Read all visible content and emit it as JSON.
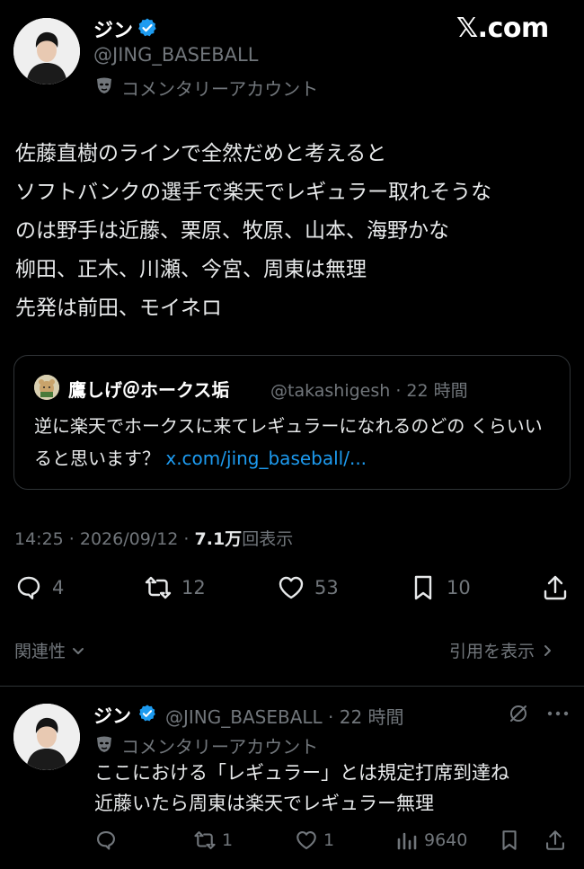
{
  "brand": "𝕏.com",
  "tweet": {
    "name": "ジン",
    "handle": "@JING_BASEBALL",
    "label": "コメンタリーアカウント",
    "body": "佐藤直樹のラインで全然だめと考えると\nソフトバンクの選手で楽天でレギュラー取れそうな\nのは野手は近藤、栗原、牧原、山本、海野かな\n柳田、正木、川瀬、今宮、周東は無理\n先発は前田、モイネロ",
    "timestamp": "14:25 · 2026/09/12 · ",
    "views": "7.1万",
    "views_suffix": "回表示"
  },
  "quote": {
    "name": "鷹しげ＠ホークス垢",
    "meta": "@takashigesh · 22 時間",
    "text": "逆に楽天でホークスに来てレギュラーになれるのどの くらいいると思います？ ",
    "link": "x.com/jing_baseball/..."
  },
  "actions": {
    "reply": "4",
    "retweet": "12",
    "like": "53",
    "bookmark": "10"
  },
  "related_label": "関連性",
  "show_quotes_label": "引用を表示",
  "reply": {
    "name": "ジン",
    "handle_time": "@JING_BASEBALL · 22 時間",
    "label": "コメンタリーアカウント",
    "body": "ここにおける「レギュラー」とは規定打席到達ね\n近藤いたら周東は楽天でレギュラー無理",
    "retweets": "1",
    "likes": "1",
    "views": "9640"
  },
  "colors": {
    "background": "#000000",
    "text": "#e7e9ea",
    "muted": "#71767b",
    "link": "#1d9bf0",
    "verified": "#1d9bf0",
    "border": "#2f3336"
  },
  "icons": [
    "verified-badge-icon",
    "mask-icon",
    "reply-icon",
    "retweet-icon",
    "like-icon",
    "bookmark-icon",
    "share-icon",
    "chevron-down-icon",
    "chevron-right-icon",
    "grok-icon",
    "more-icon",
    "views-icon"
  ]
}
